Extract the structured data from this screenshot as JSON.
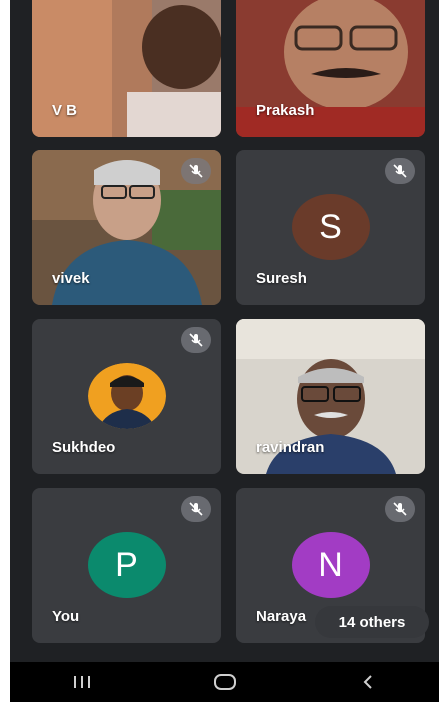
{
  "participants": [
    {
      "name": "V B",
      "type": "video"
    },
    {
      "name": "Prakash",
      "type": "video"
    },
    {
      "name": "vivek",
      "type": "video",
      "muted": true
    },
    {
      "name": "Suresh",
      "type": "initial",
      "initial": "S",
      "color": "#6a3b2a",
      "muted": true
    },
    {
      "name": "Sukhdeo",
      "type": "photo",
      "muted": true
    },
    {
      "name": "ravindran",
      "type": "video"
    },
    {
      "name": "You",
      "type": "initial",
      "initial": "P",
      "color": "#0b8a6d",
      "muted": true
    },
    {
      "name": "Naraya",
      "type": "initial",
      "initial": "N",
      "color": "#a23cc4",
      "muted": true
    }
  ],
  "others_badge": "14 others",
  "nav": {
    "recent": "recent-apps-icon",
    "home": "home-icon",
    "back": "back-icon"
  }
}
